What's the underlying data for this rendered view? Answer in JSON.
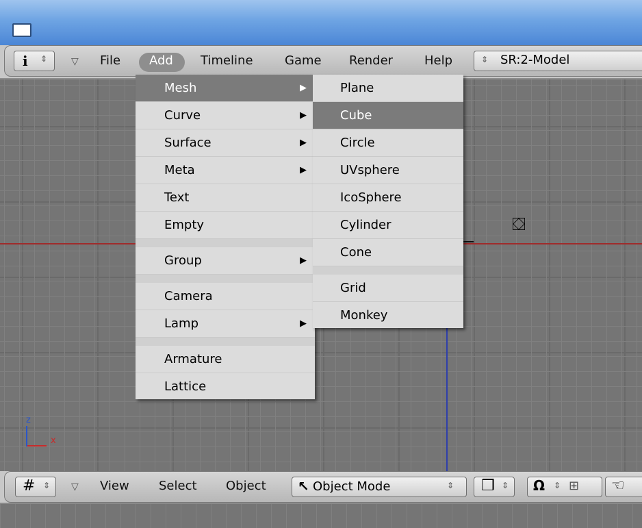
{
  "header": {
    "menus": [
      "File",
      "Add",
      "Timeline",
      "Game",
      "Render",
      "Help"
    ],
    "info_icon": "info-icon",
    "scene": "SR:2-Model"
  },
  "add_menu": {
    "items": [
      {
        "label": "Mesh",
        "submenu": true,
        "highlighted": true
      },
      {
        "label": "Curve",
        "submenu": true
      },
      {
        "label": "Surface",
        "submenu": true
      },
      {
        "label": "Meta",
        "submenu": true
      },
      {
        "label": "Text"
      },
      {
        "label": "Empty"
      },
      {
        "label": "Group",
        "submenu": true
      },
      {
        "label": "Camera"
      },
      {
        "label": "Lamp",
        "submenu": true
      },
      {
        "label": "Armature"
      },
      {
        "label": "Lattice"
      }
    ]
  },
  "mesh_menu": {
    "items": [
      {
        "label": "Plane"
      },
      {
        "label": "Cube",
        "highlighted": true
      },
      {
        "label": "Circle"
      },
      {
        "label": "UVsphere"
      },
      {
        "label": "IcoSphere"
      },
      {
        "label": "Cylinder"
      },
      {
        "label": "Cone"
      },
      {
        "label": "Grid"
      },
      {
        "label": "Monkey"
      }
    ]
  },
  "view_header": {
    "menus": [
      "View",
      "Select",
      "Object"
    ],
    "mode": "Object Mode"
  },
  "axes": {
    "z": "z",
    "x": "x"
  },
  "colors": {
    "highlight": "#7b7b7b",
    "x_axis": "#a02b2b",
    "y_axis": "#2f3faa"
  }
}
